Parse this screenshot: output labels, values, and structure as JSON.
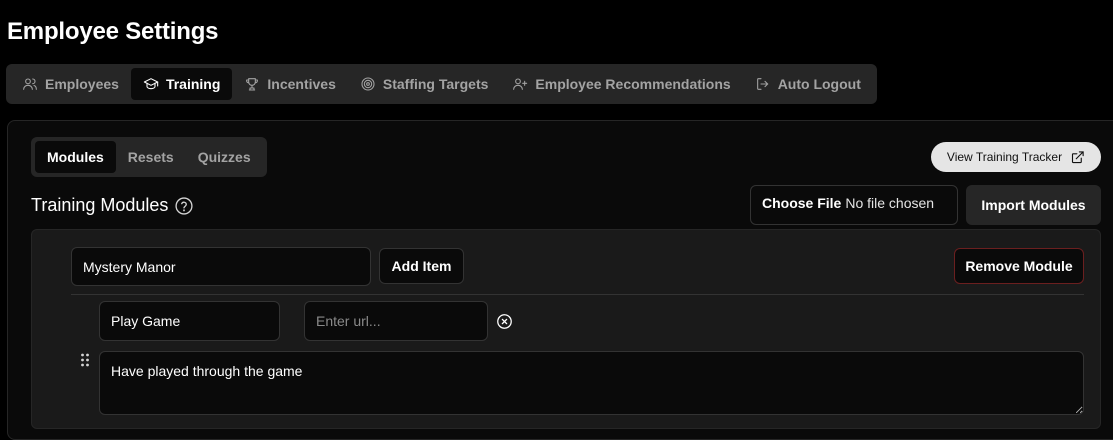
{
  "page": {
    "title": "Employee Settings"
  },
  "top_tabs": [
    {
      "label": "Employees",
      "icon": "users-icon",
      "active": false
    },
    {
      "label": "Training",
      "icon": "graduation-cap-icon",
      "active": true
    },
    {
      "label": "Incentives",
      "icon": "trophy-icon",
      "active": false
    },
    {
      "label": "Staffing Targets",
      "icon": "target-icon",
      "active": false
    },
    {
      "label": "Employee Recommendations",
      "icon": "user-plus-icon",
      "active": false
    },
    {
      "label": "Auto Logout",
      "icon": "logout-icon",
      "active": false
    }
  ],
  "sub_tabs": [
    {
      "label": "Modules",
      "active": true
    },
    {
      "label": "Resets",
      "active": false
    },
    {
      "label": "Quizzes",
      "active": false
    }
  ],
  "tracker_button": {
    "label": "View Training Tracker",
    "icon": "external-link-icon"
  },
  "section": {
    "title": "Training Modules",
    "icon": "help-circle-icon"
  },
  "file_input": {
    "choose_label": "Choose File",
    "status": "No file chosen"
  },
  "import_button": {
    "label": "Import Modules"
  },
  "module": {
    "name_value": "Mystery Manor",
    "add_item_label": "Add Item",
    "remove_label": "Remove Module",
    "items": [
      {
        "title_value": "Play Game",
        "url_placeholder": "Enter url...",
        "description": "Have played through the game"
      }
    ]
  },
  "colors": {
    "background": "#000000",
    "tab_bar": "#262626",
    "active_tab": "#0a0a0a",
    "danger_border": "#6b1f1f"
  }
}
